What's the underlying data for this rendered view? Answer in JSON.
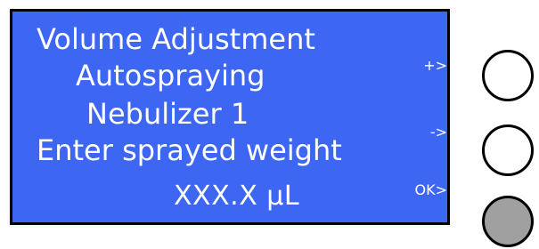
{
  "colors": {
    "screen_bg": "#3d66f2",
    "button_light": "#ffffff",
    "button_ok": "#a0a0a0"
  },
  "display": {
    "title": "Volume Adjustment",
    "mode": "Autospraying",
    "device": "Nebulizer 1",
    "prompt": "Enter sprayed weight",
    "value": "XXX.X μL"
  },
  "softkeys": {
    "plus": "+>",
    "minus": "->",
    "ok": "OK>"
  }
}
